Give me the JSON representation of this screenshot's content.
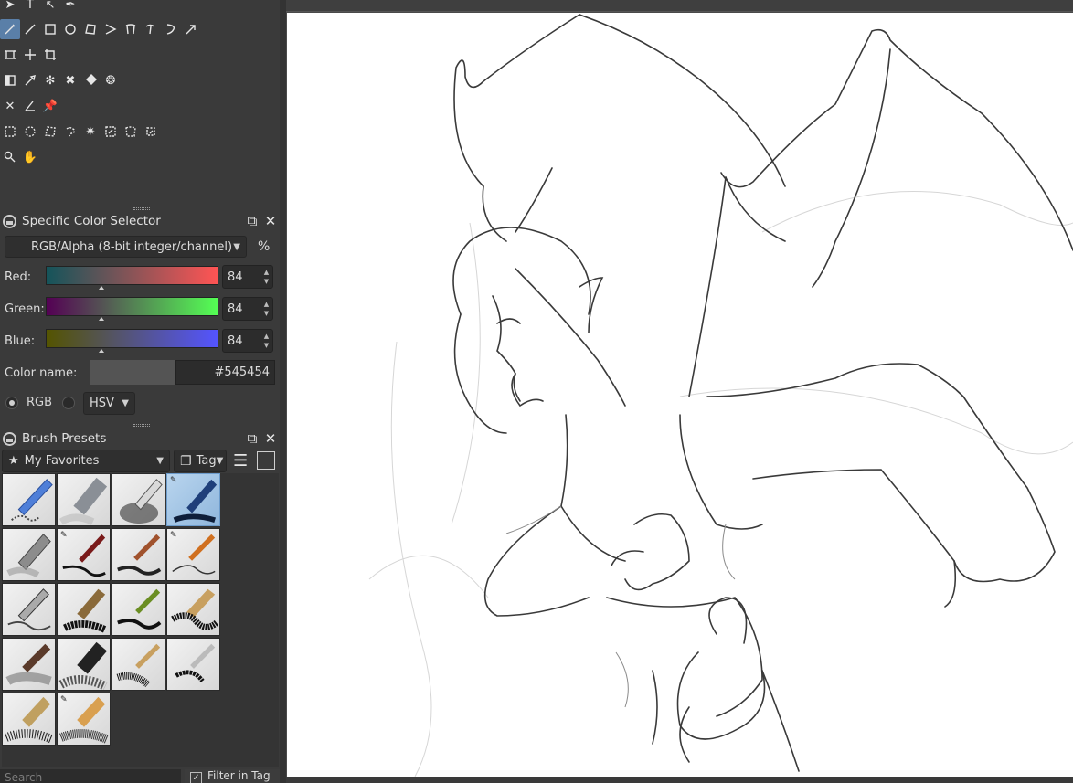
{
  "toolbox": {
    "rows": [
      [
        "select-shapes-icon",
        "text-icon",
        "edit-shapes-icon",
        "calligraphy-icon"
      ],
      [
        "freehand-brush-icon",
        "line-icon",
        "rectangle-icon",
        "ellipse-icon",
        "polygon-icon",
        "polyline-icon",
        "bezier-icon",
        "freehand-path-icon",
        "dynamic-brush-icon",
        "multibrush-icon"
      ],
      [
        "transform-icon",
        "move-icon",
        "crop-icon"
      ],
      [
        "gradient-icon",
        "color-picker-icon",
        "colorize-mask-icon",
        "smart-patch-icon",
        "fill-icon",
        "enclose-fill-icon"
      ],
      [
        "assistant-icon",
        "measure-icon",
        "reference-icon"
      ],
      [
        "rect-select-icon",
        "ellipse-select-icon",
        "polygon-select-icon",
        "freehand-select-icon",
        "contiguous-select-icon",
        "similar-select-icon",
        "bezier-select-icon",
        "magnetic-select-icon"
      ],
      [
        "zoom-icon",
        "pan-icon"
      ]
    ]
  },
  "color_selector": {
    "title": "Specific Color Selector",
    "color_space": "RGB/Alpha (8-bit integer/channel)",
    "percent_toggle": "%",
    "channels": [
      {
        "label": "Red:",
        "value": "84",
        "level": 0.33
      },
      {
        "label": "Green:",
        "value": "84",
        "level": 0.33
      },
      {
        "label": "Blue:",
        "value": "84",
        "level": 0.33
      }
    ],
    "color_name_label": "Color name:",
    "color_hex": "#545454",
    "swatch": "#545454",
    "radio_rgb": "RGB",
    "radio_hsv": "HSV"
  },
  "brush_presets": {
    "title": "Brush Presets",
    "tag_filter": "My Favorites",
    "tag_button": "Tag",
    "search_placeholder": "Search",
    "filter_in_tag": "Filter in Tag"
  }
}
